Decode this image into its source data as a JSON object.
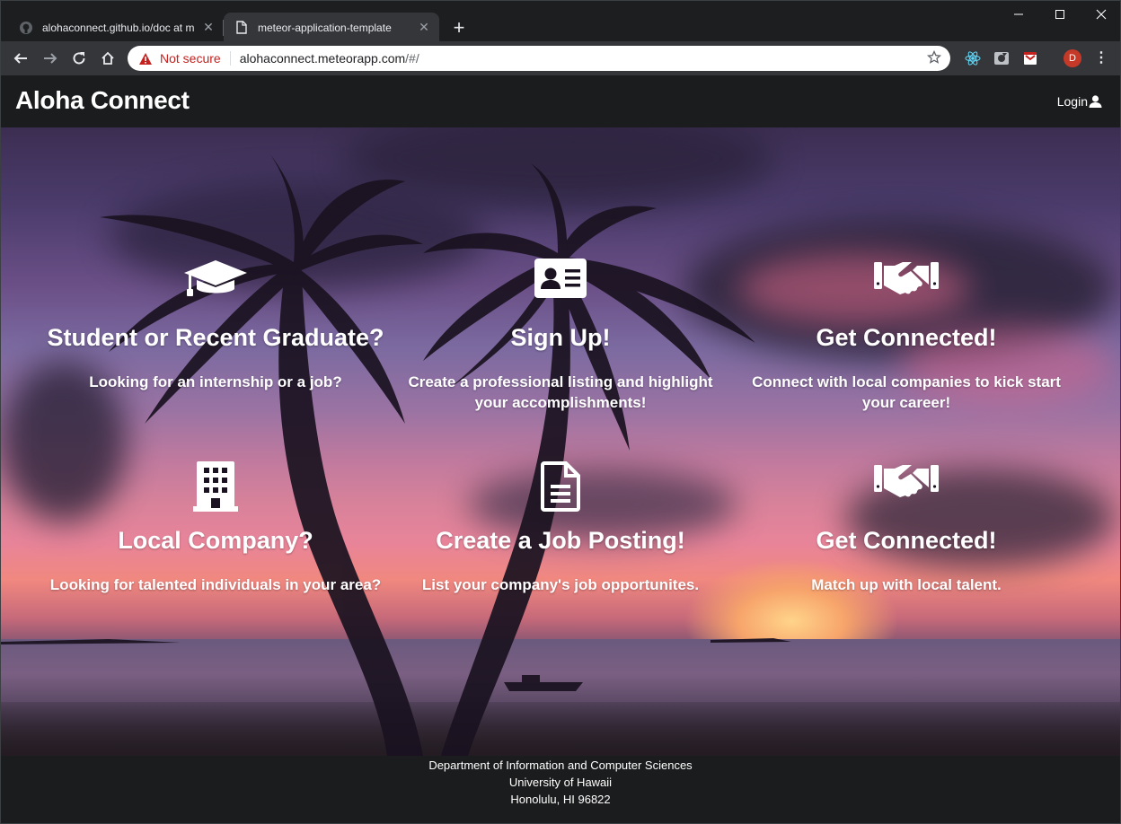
{
  "browser": {
    "tabs": [
      {
        "title": "alohaconnect.github.io/doc at m",
        "active": false,
        "favicon": "github-icon"
      },
      {
        "title": "meteor-application-template",
        "active": true,
        "favicon": "page-icon"
      }
    ],
    "new_tab_label": "+",
    "address": {
      "security_label": "Not secure",
      "host": "alohaconnect.meteorapp.com",
      "path": "/#/"
    },
    "profile_initial": "D"
  },
  "navbar": {
    "brand": "Aloha Connect",
    "login_label": "Login"
  },
  "sections": [
    {
      "icon": "graduation-cap-icon",
      "title": "Student or Recent Graduate?",
      "text": "Looking for an internship or a job?"
    },
    {
      "icon": "id-card-icon",
      "title": "Sign Up!",
      "text": "Create a professional listing and highlight your accomplishments!"
    },
    {
      "icon": "handshake-icon",
      "title": "Get Connected!",
      "text": "Connect with local companies to kick start your career!"
    },
    {
      "icon": "building-icon",
      "title": "Local Company?",
      "text": "Looking for talented individuals in your area?"
    },
    {
      "icon": "file-icon",
      "title": "Create a Job Posting!",
      "text": "List your company's job opportunites."
    },
    {
      "icon": "handshake-icon",
      "title": "Get Connected!",
      "text": "Match up with local talent."
    }
  ],
  "footer": {
    "line1": "Department of Information and Computer Sciences",
    "line2": "University of Hawaii",
    "line3": "Honolulu, HI 96822"
  }
}
